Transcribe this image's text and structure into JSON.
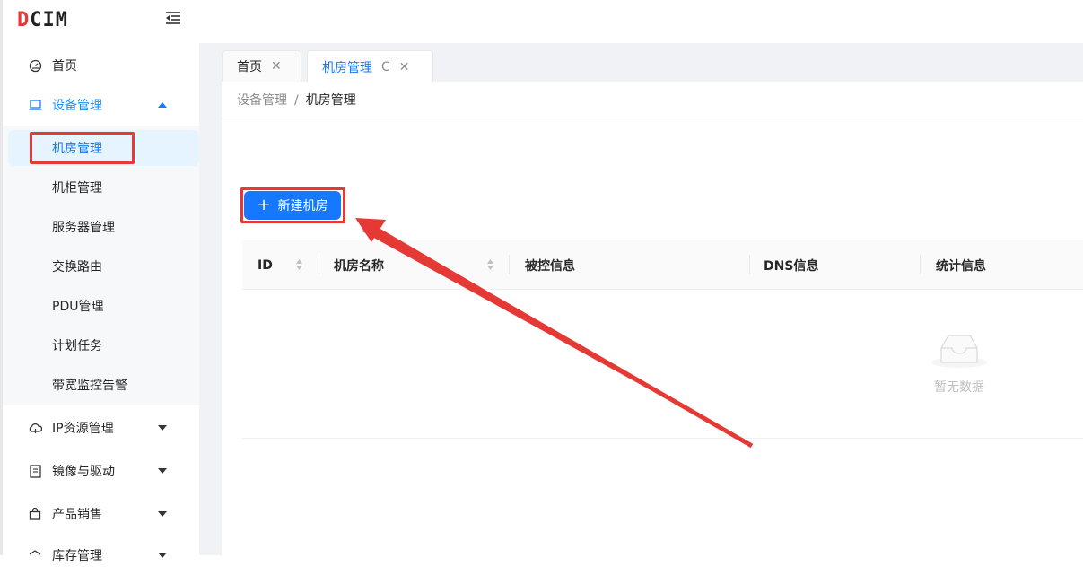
{
  "app": {
    "logo_text_red": "D",
    "logo_text": "CIM"
  },
  "sidebar": {
    "items": [
      {
        "label": "首页",
        "icon": "dashboard-icon"
      },
      {
        "label": "设备管理",
        "icon": "laptop-icon"
      },
      {
        "label": "IP资源管理",
        "icon": "cloud-icon"
      },
      {
        "label": "镜像与驱动",
        "icon": "image-icon"
      },
      {
        "label": "产品销售",
        "icon": "shopping-bag-icon"
      },
      {
        "label": "库存管理",
        "icon": "inventory-icon"
      }
    ],
    "sub_items": [
      "机房管理",
      "机柜管理",
      "服务器管理",
      "交换路由",
      "PDU管理",
      "计划任务",
      "带宽监控告警"
    ]
  },
  "tabs": [
    {
      "label": "首页"
    },
    {
      "label": "机房管理"
    }
  ],
  "breadcrumb": {
    "parent": "设备管理",
    "separator": "/",
    "current": "机房管理"
  },
  "toolbar": {
    "new_button": "新建机房",
    "plus": "+"
  },
  "table": {
    "columns": [
      "ID",
      "机房名称",
      "被控信息",
      "DNS信息",
      "统计信息"
    ],
    "empty_text": "暂无数据"
  },
  "colors": {
    "primary": "#1677ff",
    "highlight": "#e53935"
  }
}
